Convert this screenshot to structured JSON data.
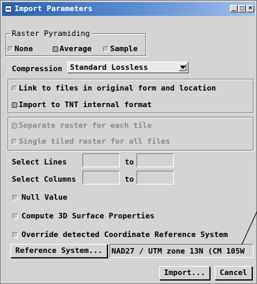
{
  "window": {
    "title": "Import Parameters"
  },
  "title_buttons": {
    "minimize": "_",
    "maximize": "□",
    "close": "×"
  },
  "raster_pyramiding": {
    "legend": "Raster Pyramiding",
    "options": [
      "None",
      "Average",
      "Sample"
    ],
    "selected": "Average"
  },
  "compression": {
    "label": "Compression",
    "value": "Standard Lossless"
  },
  "import_mode": {
    "link_label": "Link to files in original form and location",
    "import_label": "Import to TNT internal format",
    "selected": "import"
  },
  "tile_mode": {
    "separate_label": "Separate raster for each tile",
    "single_label": "Single tiled raster for all files",
    "enabled": false
  },
  "select_lines": {
    "label": "Select Lines",
    "to_label": "to",
    "from_value": "",
    "to_value": ""
  },
  "select_columns": {
    "label": "Select Columns",
    "to_label": "to",
    "from_value": "",
    "to_value": ""
  },
  "null_value": {
    "label": "Null Value",
    "checked": false
  },
  "compute_3d": {
    "label": "Compute 3D Surface Properties",
    "checked": false
  },
  "override_crs": {
    "label": "Override detected Coordinate Reference System",
    "checked": false
  },
  "reference_system": {
    "button_label": "Reference System...",
    "value": "NAD27 / UTM zone 13N (CM 105W"
  },
  "actions": {
    "import_label": "Import...",
    "cancel_label": "Cancel"
  },
  "colors": {
    "titlebar_start": "#2a5fa8",
    "titlebar_end": "#9fc0ea",
    "dialog_bg": "#d4d4d4"
  }
}
